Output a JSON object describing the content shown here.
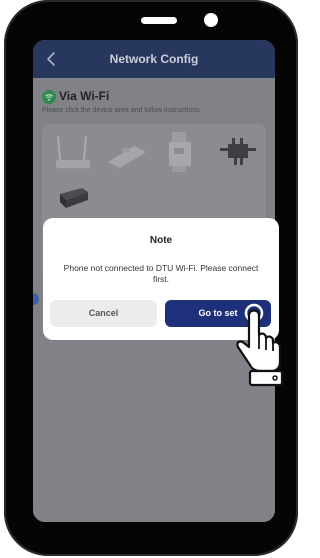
{
  "header": {
    "title": "Network Config"
  },
  "section": {
    "title": "Via Wi-Fi",
    "instructions": "Please click the device area and follow instructions"
  },
  "devices": [
    {
      "icon": "router-icon"
    },
    {
      "icon": "dtu-stick-icon"
    },
    {
      "icon": "din-rail-dtu-icon"
    },
    {
      "icon": "microinverter-icon"
    },
    {
      "icon": "meter-icon"
    }
  ],
  "dialog": {
    "title": "Note",
    "message": "Phone not connected to DTU Wi-Fi. Please connect first.",
    "cancel_label": "Cancel",
    "confirm_label": "Go to set"
  },
  "colors": {
    "navbar": "#28375e",
    "primary_button": "#1d3079",
    "wifi_icon": "#2f8a52",
    "overlay": "#7d7f86"
  }
}
